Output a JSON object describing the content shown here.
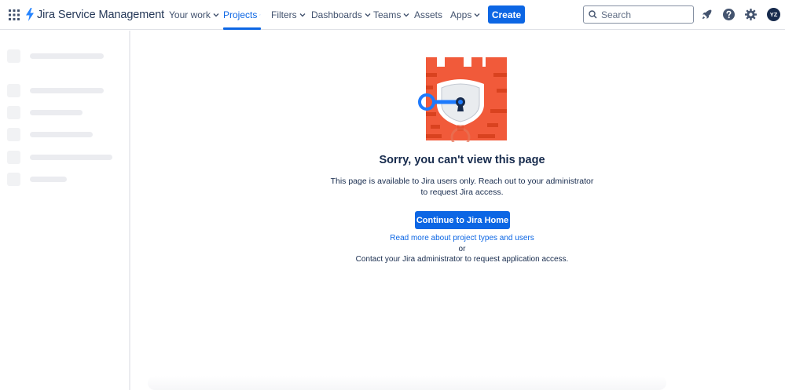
{
  "header": {
    "product_name": "Jira Service Management",
    "nav": [
      {
        "label": "Your work",
        "dropdown": true,
        "active": false
      },
      {
        "label": "Projects",
        "dropdown": true,
        "active": true
      },
      {
        "label": "Filters",
        "dropdown": true,
        "active": false
      },
      {
        "label": "Dashboards",
        "dropdown": true,
        "active": false
      },
      {
        "label": "Teams",
        "dropdown": true,
        "active": false
      },
      {
        "label": "Assets",
        "dropdown": false,
        "active": false
      },
      {
        "label": "Apps",
        "dropdown": true,
        "active": false
      }
    ],
    "create_label": "Create",
    "search_placeholder": "Search",
    "icons": [
      "notifications-rocket-icon",
      "help-icon",
      "settings-icon"
    ],
    "avatar_initials": "YZ"
  },
  "main": {
    "title": "Sorry, you can't view this page",
    "description_line1": "This page is available to Jira users only. Reach out to your administrator",
    "description_line2": "to request Jira access.",
    "continue_label": "Continue to Jira Home",
    "read_more_link": "Read more about project types and users",
    "or_text": "or",
    "contact_text": "Contact your Jira administrator to request application access."
  },
  "colors": {
    "brand_blue": "#0c66e4",
    "text_dark": "#172b4d",
    "castle_red": "#f15a3a",
    "castle_dark": "#d9421f"
  }
}
